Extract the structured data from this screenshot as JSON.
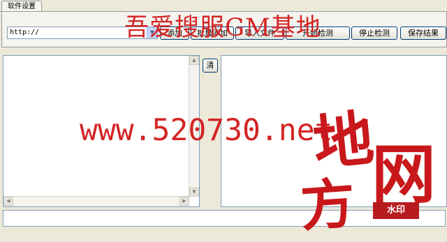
{
  "tabs": {
    "active": "软件设置"
  },
  "toolbar": {
    "url_value": "http://",
    "buttons": [
      "添加",
      "批量添加",
      "导入文件",
      "开始检测",
      "停止检测",
      "保存结果"
    ]
  },
  "actions": {
    "clear_label": "清"
  },
  "watermark": {
    "title": "吾爱搜服GM基地",
    "url": "www.520730.net",
    "logo_chars": [
      "地",
      "网",
      "方"
    ],
    "seal": "水印"
  },
  "colors": {
    "watermark_red": "#d32424",
    "seal_red": "#b71a1f"
  }
}
